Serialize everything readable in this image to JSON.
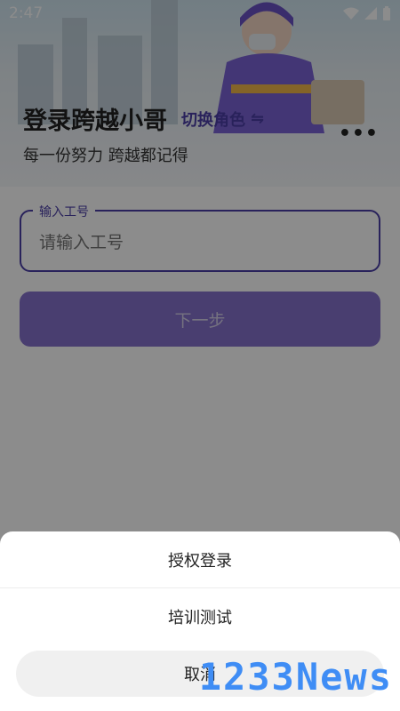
{
  "status_bar": {
    "time": "2:47",
    "icons": [
      "wifi-icon",
      "signal-icon",
      "battery-icon"
    ]
  },
  "header": {
    "title": "登录跨越小哥",
    "switch_role_label": "切换角色",
    "switch_icon": "⇋",
    "subtitle": "每一份努力 跨越都记得",
    "more_label": "•••"
  },
  "form": {
    "field_label": "输入工号",
    "field_placeholder": "请输入工号",
    "next_label": "下一步"
  },
  "sheet": {
    "items": [
      "授权登录",
      "培训测试"
    ],
    "cancel_label": "取消"
  },
  "watermark": "1233News",
  "colors": {
    "accent": "#4b3ea7",
    "button": "#8672cc",
    "watermark": "#3f8df5"
  }
}
